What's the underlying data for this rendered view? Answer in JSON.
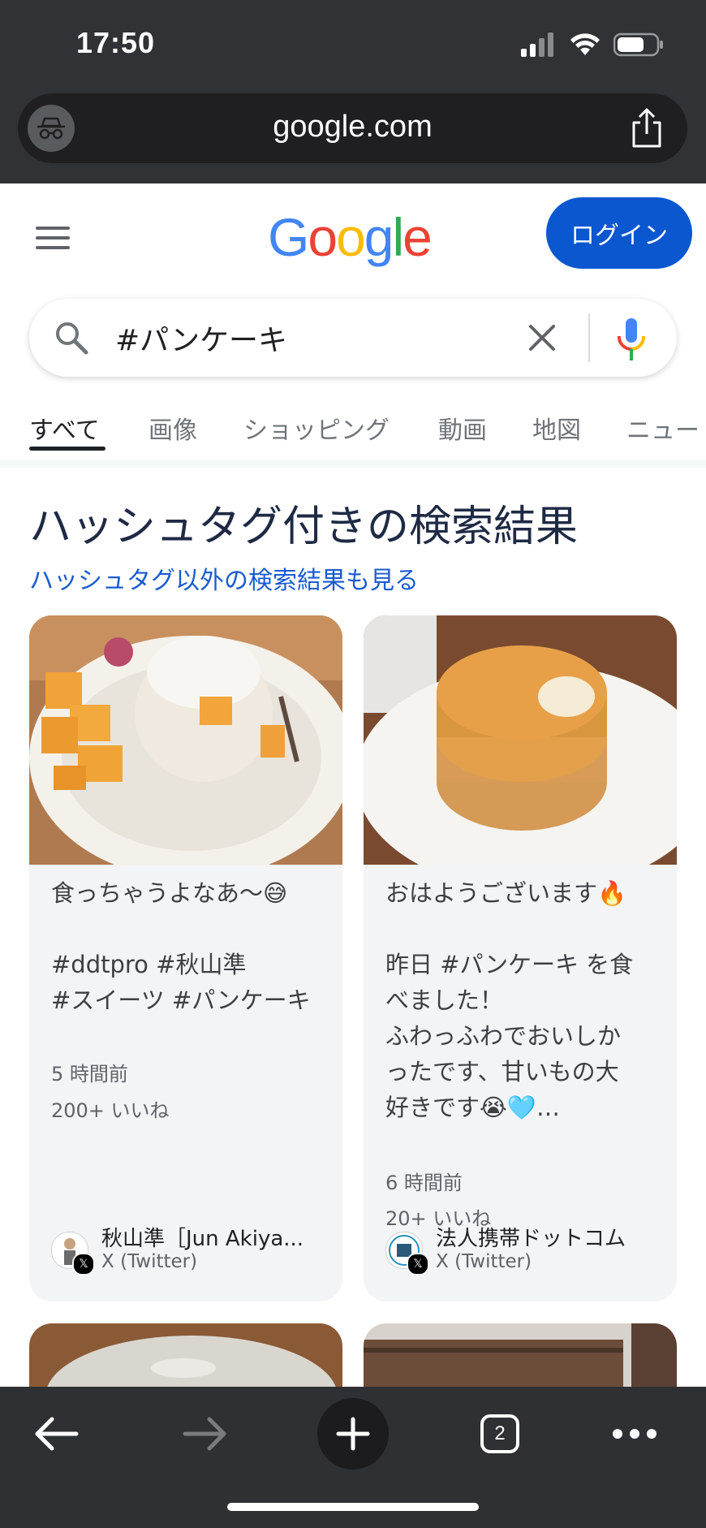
{
  "status_bar": {
    "time": "17:50"
  },
  "browser": {
    "url": "google.com",
    "tab_count": "2"
  },
  "header": {
    "logo": [
      "G",
      "o",
      "o",
      "g",
      "l",
      "e"
    ],
    "logo_colors": [
      "#4285F4",
      "#EA4335",
      "#FBBC05",
      "#4285F4",
      "#34A853",
      "#EA4335"
    ],
    "login_label": "ログイン"
  },
  "search": {
    "value": "#パンケーキ"
  },
  "tabs": [
    {
      "label": "すべて",
      "active": true
    },
    {
      "label": "画像"
    },
    {
      "label": "ショッピング"
    },
    {
      "label": "動画"
    },
    {
      "label": "地図"
    },
    {
      "label": "ニュー"
    }
  ],
  "results": {
    "heading": "ハッシュタグ付きの検索結果",
    "other_results_link": "ハッシュタグ以外の検索結果も見る",
    "cards": [
      {
        "text": "食っちゃうよなあ〜😅\n\n#ddtpro #秋山準\n#スイーツ #パンケーキ",
        "time": "5 時間前",
        "likes": "200+ いいね",
        "author": "秋山準［Jun Akiya...",
        "source": "X (Twitter)"
      },
      {
        "text": "おはようございます🔥\n\n昨日 #パンケーキ を食\nべました！\nふわっふわでおいしか\nったです、甘いもの大\n好きです😭🩵…",
        "time": "6 時間前",
        "likes": "20+ いいね",
        "author": "法人携帯ドットコム",
        "source": "X (Twitter)"
      }
    ]
  },
  "colors": {
    "chrome": "#313235",
    "login_button": "#0b57d0",
    "link": "#1a5ccf",
    "card_bg": "#f3f4f6"
  }
}
